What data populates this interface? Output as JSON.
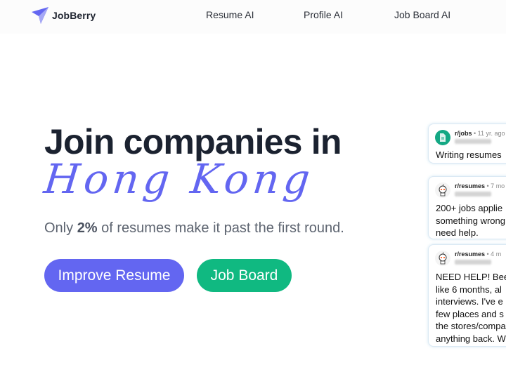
{
  "header": {
    "brand": "JobBerry",
    "nav": [
      "Resume AI",
      "Profile AI",
      "Job Board AI"
    ]
  },
  "hero": {
    "title": "Join companies in",
    "location": "Hong Kong",
    "subtitle_prefix": "Only ",
    "subtitle_highlight": "2%",
    "subtitle_suffix": " of resumes make it past the first round.",
    "primary_button": "Improve Resume",
    "secondary_button": "Job Board"
  },
  "cards": [
    {
      "subreddit": "r/jobs",
      "time": " • 11 yr. ago",
      "avatar": "document-icon",
      "lines": [
        "Writing resumes"
      ]
    },
    {
      "subreddit": "r/resumes",
      "time": " • 7 mo",
      "avatar": "reddit-snoo-icon",
      "lines": [
        "200+ jobs applie",
        "something wrong",
        "need help."
      ]
    },
    {
      "subreddit": "r/resumes",
      "time": " • 4 m",
      "avatar": "reddit-snoo-icon",
      "lines": [
        "NEED HELP! Bee",
        "like 6 months, al",
        "interviews. I've e",
        "few places and s",
        "the stores/compa",
        "anything back. W"
      ]
    }
  ],
  "colors": {
    "brand_primary": "#6366f1",
    "brand_secondary": "#10b981",
    "heading": "#1b2230"
  }
}
